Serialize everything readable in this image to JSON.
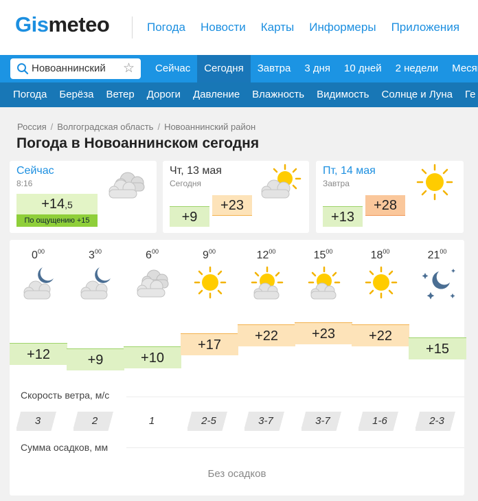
{
  "header": {
    "logo_part1": "Gis",
    "logo_part2": "meteo",
    "nav": [
      "Погода",
      "Новости",
      "Карты",
      "Информеры",
      "Приложения"
    ]
  },
  "search": {
    "value": "Новоаннинский"
  },
  "day_tabs": [
    "Сейчас",
    "Сегодня",
    "Завтра",
    "3 дня",
    "10 дней",
    "2 недели",
    "Месяц"
  ],
  "active_tab": "Сегодня",
  "sub_nav": [
    "Погода",
    "Берёза",
    "Ветер",
    "Дороги",
    "Давление",
    "Влажность",
    "Видимость",
    "Солнце и Луна",
    "Ге"
  ],
  "breadcrumb": [
    "Россия",
    "Волгоградская область",
    "Новоаннинский район"
  ],
  "page_title": "Погода в Новоаннинском сегодня",
  "now": {
    "title": "Сейчас",
    "time": "8:16",
    "temp_main": "+14",
    "temp_fraction": ",5",
    "feels_like": "По ощущению +15",
    "icon": "cloudy-icon"
  },
  "today": {
    "title": "Чт, 13 мая",
    "label": "Сегодня",
    "min": "+9",
    "max": "+23",
    "icon": "partly-cloudy-icon"
  },
  "tomorrow": {
    "title": "Пт, 14 мая",
    "label": "Завтра",
    "min": "+13",
    "max": "+28",
    "icon": "sun-icon"
  },
  "hourly": [
    {
      "hour": "0",
      "min": "00",
      "icon": "night-cloudy-icon",
      "temp": "+12",
      "temp_value": 12,
      "wind": "3"
    },
    {
      "hour": "3",
      "min": "00",
      "icon": "night-cloudy-icon",
      "temp": "+9",
      "temp_value": 9,
      "wind": "2"
    },
    {
      "hour": "6",
      "min": "00",
      "icon": "cloudy-icon",
      "temp": "+10",
      "temp_value": 10,
      "wind": "1"
    },
    {
      "hour": "9",
      "min": "00",
      "icon": "sun-icon",
      "temp": "+17",
      "temp_value": 17,
      "wind": "2-5"
    },
    {
      "hour": "12",
      "min": "00",
      "icon": "partly-cloudy-icon",
      "temp": "+22",
      "temp_value": 22,
      "wind": "3-7"
    },
    {
      "hour": "15",
      "min": "00",
      "icon": "partly-cloudy-icon",
      "temp": "+23",
      "temp_value": 23,
      "wind": "3-7"
    },
    {
      "hour": "18",
      "min": "00",
      "icon": "sun-icon",
      "temp": "+22",
      "temp_value": 22,
      "wind": "1-6"
    },
    {
      "hour": "21",
      "min": "00",
      "icon": "clear-night-icon",
      "temp": "+15",
      "temp_value": 15,
      "wind": "2-3"
    }
  ],
  "wind_label": "Скорость ветра, м/с",
  "precip_label": "Сумма осадков, мм",
  "precip_value": "Без осадков",
  "colors": {
    "brand": "#1c8fe0",
    "nav_blue": "#1c94e3",
    "nav_dark": "#1877b6",
    "cool": "#dff1c4",
    "warm": "#fde3b9"
  }
}
